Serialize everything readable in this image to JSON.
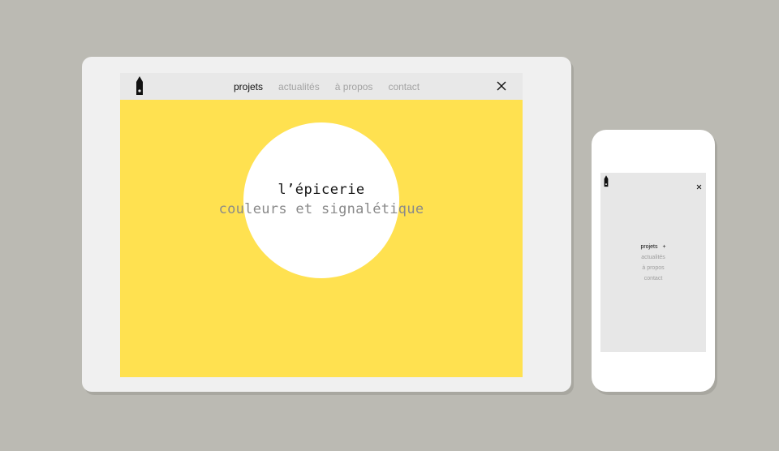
{
  "tablet": {
    "nav": {
      "items": [
        {
          "label": "projets",
          "active": true
        },
        {
          "label": "actualités",
          "active": false
        },
        {
          "label": "à propos",
          "active": false
        },
        {
          "label": "contact",
          "active": false
        }
      ],
      "logo_icon": "pen-tower-logo-icon",
      "close_icon": "close-icon"
    },
    "hero": {
      "title": "l’épicerie",
      "subtitle": "couleurs et signalétique",
      "background_color": "#ffe150",
      "circle_color": "#ffffff"
    }
  },
  "phone": {
    "menu": {
      "items": [
        {
          "label": "projets",
          "active": true,
          "suffix": "+"
        },
        {
          "label": "actualités",
          "active": false
        },
        {
          "label": "à propos",
          "active": false
        },
        {
          "label": "contact",
          "active": false
        }
      ]
    },
    "logo_icon": "pen-tower-logo-icon",
    "close_icon": "close-icon"
  },
  "colors": {
    "page_background": "#bbbab3",
    "accent_yellow": "#ffe150",
    "inactive_text": "#a3a3a3",
    "active_text": "#111111"
  }
}
